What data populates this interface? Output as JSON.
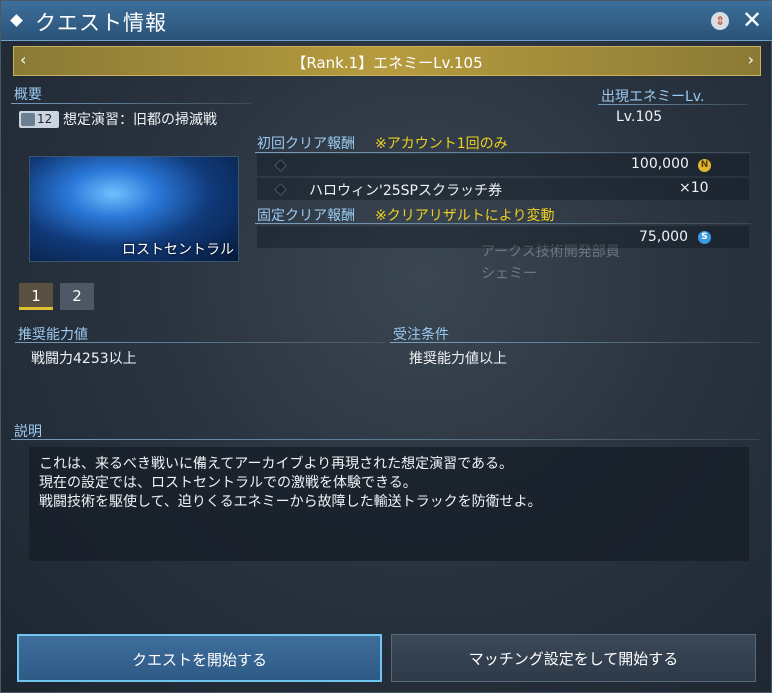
{
  "window": {
    "title": "クエスト情報",
    "help_icon": "help-icon",
    "close_icon": "close-icon"
  },
  "rank_bar": {
    "label": "【Rank.1】エネミーLv.105",
    "prev_icon": "chevron-left-icon",
    "next_icon": "chevron-right-icon"
  },
  "overview": {
    "label": "概要",
    "party_count": "12",
    "quest_name": "想定演習：旧都の掃滅戦",
    "area_name": "ロストセントラル"
  },
  "enemy": {
    "label": "出現エネミーLv.",
    "value": "Lv.105"
  },
  "first_clear": {
    "label": "初回クリア報酬",
    "note": "※アカウント1回のみ",
    "rows": [
      {
        "name": "",
        "value": "100,000",
        "currency_icon": "n-meseta-icon"
      },
      {
        "name": "ハロウィン'25SPスクラッチ券",
        "value": "×10"
      }
    ]
  },
  "fixed_clear": {
    "label": "固定クリア報酬",
    "note": "※クリアリザルトにより変動",
    "rows": [
      {
        "name": "",
        "value": "75,000",
        "currency_icon": "s-meseta-icon"
      }
    ]
  },
  "pages": [
    "1",
    "2"
  ],
  "recommended": {
    "label": "推奨能力値",
    "value": "戦闘力4253以上"
  },
  "conditions": {
    "label": "受注条件",
    "value": "推奨能力値以上"
  },
  "description": {
    "label": "説明",
    "lines": [
      "これは、来るべき戦いに備えてアーカイブより再現された想定演習である。",
      "現在の設定では、ロストセントラルでの激戦を体験できる。",
      "戦闘技術を駆使して、迫りくるエネミーから故障した輸送トラックを防衛せよ。"
    ]
  },
  "background_npc": {
    "line1": "アークス技術開発部員",
    "line2": "シェミー"
  },
  "buttons": {
    "start": "クエストを開始する",
    "matching": "マッチング設定をして開始する"
  },
  "colors": {
    "accent_gold": "#f0d020",
    "label_blue": "#9ccaf0",
    "title_bar": "#2b5378"
  }
}
